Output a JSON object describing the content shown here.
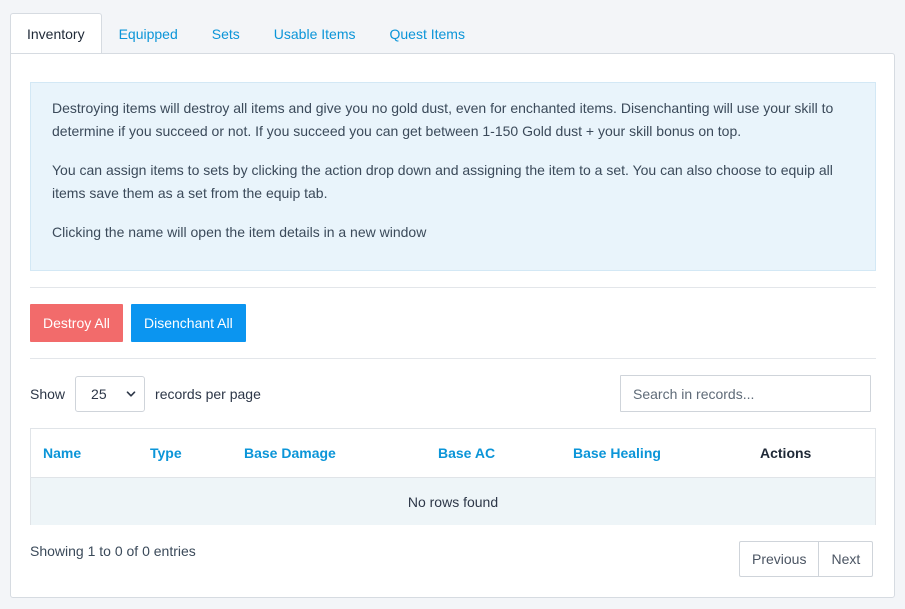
{
  "tabs": [
    {
      "label": "Inventory",
      "active": true
    },
    {
      "label": "Equipped"
    },
    {
      "label": "Sets"
    },
    {
      "label": "Usable Items"
    },
    {
      "label": "Quest Items"
    }
  ],
  "notice": {
    "paragraphs": [
      "Destroying items will destroy all items and give you no gold dust, even for enchanted items. Disenchanting will use your skill to determine if you succeed or not. If you succeed you can get between 1-150 Gold dust + your skill bonus on top.",
      "You can assign items to sets by clicking the action drop down and assigning the item to a set. You can also choose to equip all items save them as a set from the equip tab.",
      "Clicking the name will open the item details in a new window"
    ]
  },
  "actions": {
    "destroy_all": "Destroy All",
    "disenchant_all": "Disenchant All"
  },
  "records": {
    "show_label": "Show",
    "per_page_value": "25",
    "per_page_suffix": "records per page",
    "search_placeholder": "Search in records..."
  },
  "table": {
    "columns": [
      "Name",
      "Type",
      "Base Damage",
      "Base AC",
      "Base Healing",
      "Actions"
    ],
    "empty_message": "No rows found"
  },
  "footer": {
    "showing": "Showing 1 to 0 of 0 entries",
    "previous": "Previous",
    "next": "Next"
  },
  "colors": {
    "accent": "#0b95d8",
    "danger": "#f26b6b",
    "primary": "#0b95f0"
  }
}
